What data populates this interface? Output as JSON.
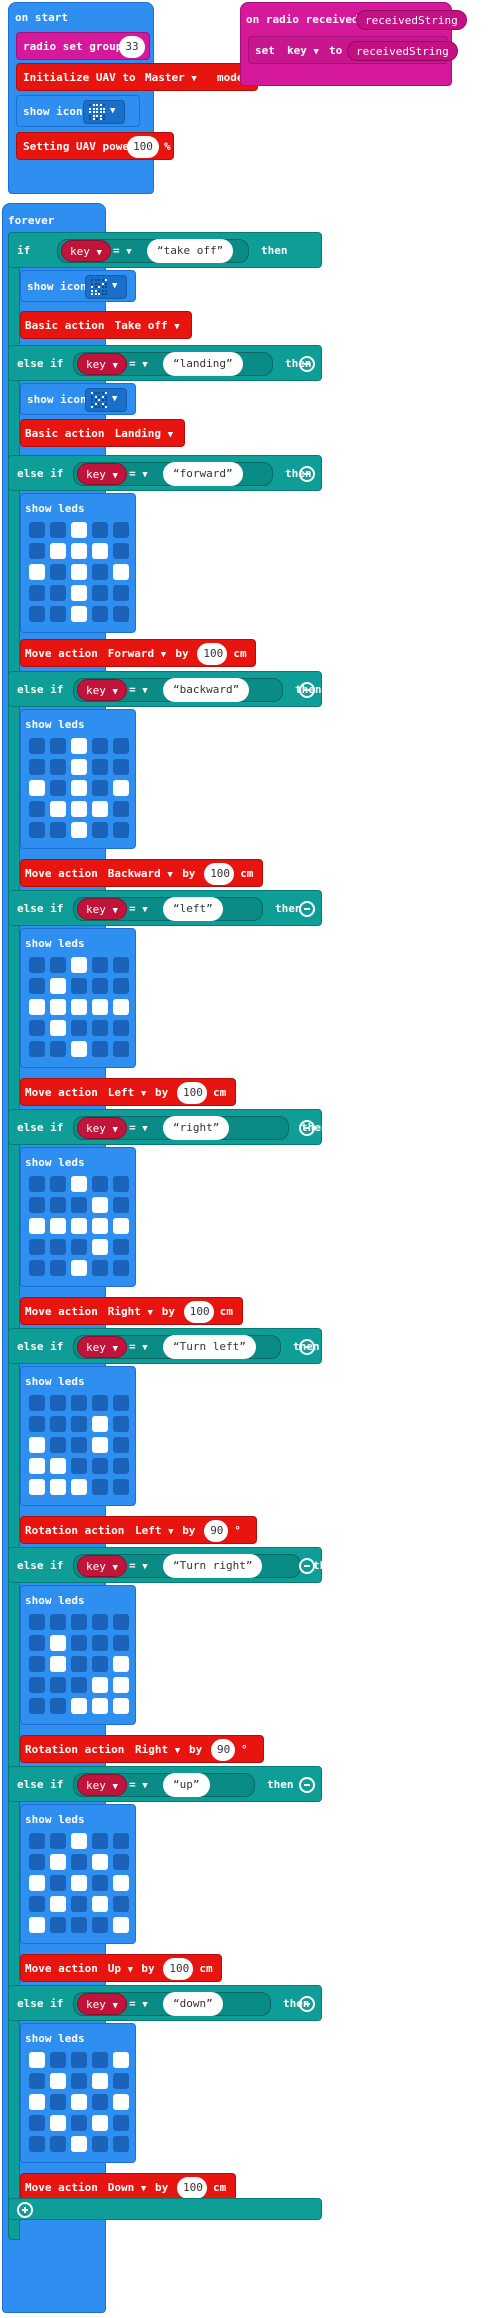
{
  "on_start": {
    "title": "on start",
    "radio_set_group": "radio set group",
    "group_value": "33",
    "init_prefix": "Initialize UAV to",
    "init_mode": "Master",
    "init_suffix": "mode",
    "show_icon": "show icon",
    "power_prefix": "Setting UAV power",
    "power_value": "100",
    "power_unit": "%"
  },
  "radio_received": {
    "title": "on radio received",
    "param": "receivedString",
    "set_label": "set",
    "set_var": "key",
    "to_label": "to",
    "to_value": "receivedString"
  },
  "forever": {
    "title": "forever",
    "if_label": "if",
    "else_if_label": "else if",
    "then_label": "then",
    "key_var": "key",
    "eq_op": "=",
    "show_icon_label": "show icon",
    "show_leds_label": "show leds",
    "branches": [
      {
        "cond": "take off",
        "action_label": "Basic action",
        "action": "Take off"
      },
      {
        "cond": "landing",
        "action_label": "Basic action",
        "action": "Landing"
      },
      {
        "cond": "forward",
        "action_label": "Move action",
        "action": "Forward",
        "by": "by",
        "value": "100",
        "unit": "cm",
        "leds": [
          0,
          0,
          1,
          0,
          0,
          0,
          1,
          1,
          1,
          0,
          1,
          0,
          1,
          0,
          1,
          0,
          0,
          1,
          0,
          0,
          0,
          0,
          1,
          0,
          0
        ]
      },
      {
        "cond": "backward",
        "action_label": "Move action",
        "action": "Backward",
        "by": "by",
        "value": "100",
        "unit": "cm",
        "leds": [
          0,
          0,
          1,
          0,
          0,
          0,
          0,
          1,
          0,
          0,
          1,
          0,
          1,
          0,
          1,
          0,
          1,
          1,
          1,
          0,
          0,
          0,
          1,
          0,
          0
        ]
      },
      {
        "cond": "left",
        "action_label": "Move action",
        "action": "Left",
        "by": "by",
        "value": "100",
        "unit": "cm",
        "leds": [
          0,
          0,
          1,
          0,
          0,
          0,
          1,
          0,
          0,
          0,
          1,
          1,
          1,
          1,
          1,
          0,
          1,
          0,
          0,
          0,
          0,
          0,
          1,
          0,
          0
        ]
      },
      {
        "cond": "right",
        "action_label": "Move action",
        "action": "Right",
        "by": "by",
        "value": "100",
        "unit": "cm",
        "leds": [
          0,
          0,
          1,
          0,
          0,
          0,
          0,
          0,
          1,
          0,
          1,
          1,
          1,
          1,
          1,
          0,
          0,
          0,
          1,
          0,
          0,
          0,
          1,
          0,
          0
        ]
      },
      {
        "cond": "Turn left",
        "action_label": "Rotation action",
        "action": "Left",
        "by": "by",
        "value": "90",
        "unit": "°",
        "leds": [
          0,
          0,
          0,
          0,
          0,
          0,
          0,
          0,
          1,
          0,
          1,
          0,
          0,
          1,
          0,
          1,
          1,
          0,
          0,
          0,
          1,
          1,
          1,
          0,
          0
        ]
      },
      {
        "cond": "Turn right",
        "action_label": "Rotation action",
        "action": "Right",
        "by": "by",
        "value": "90",
        "unit": "°",
        "leds": [
          0,
          0,
          0,
          0,
          0,
          0,
          1,
          0,
          0,
          0,
          0,
          1,
          0,
          0,
          1,
          0,
          0,
          0,
          1,
          1,
          0,
          0,
          1,
          1,
          1
        ]
      },
      {
        "cond": "up",
        "action_label": "Move action",
        "action": "Up",
        "by": "by",
        "value": "100",
        "unit": "cm",
        "leds": [
          0,
          0,
          1,
          0,
          0,
          0,
          1,
          0,
          1,
          0,
          1,
          0,
          1,
          0,
          1,
          0,
          1,
          0,
          1,
          0,
          1,
          0,
          0,
          0,
          1
        ]
      },
      {
        "cond": "down",
        "action_label": "Move action",
        "action": "Down",
        "by": "by",
        "value": "100",
        "unit": "cm",
        "leds": [
          1,
          0,
          0,
          0,
          1,
          0,
          1,
          0,
          1,
          0,
          1,
          0,
          1,
          0,
          1,
          0,
          1,
          0,
          1,
          0,
          0,
          0,
          1,
          0,
          0
        ]
      }
    ]
  }
}
